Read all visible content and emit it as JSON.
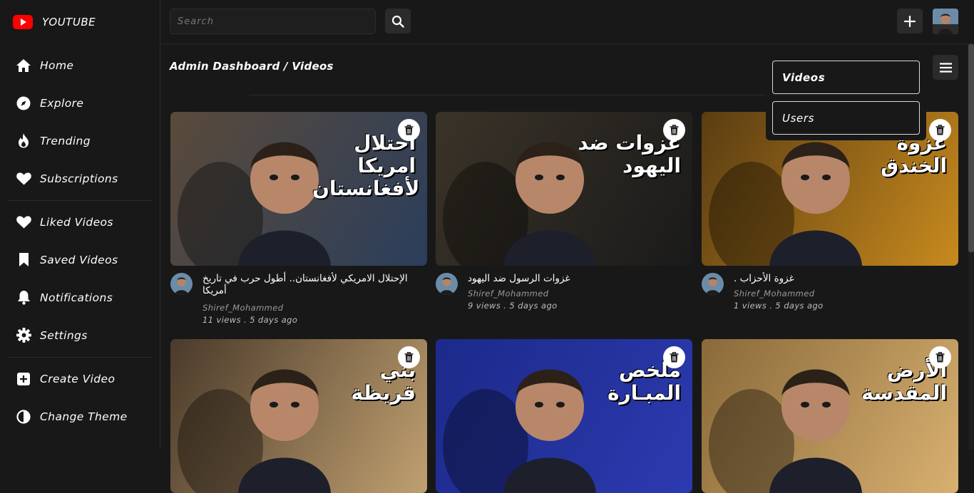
{
  "brand": {
    "name": "YOUTUBE"
  },
  "sidebar": {
    "groups": [
      [
        {
          "label": "Home",
          "icon": "home-icon"
        },
        {
          "label": "Explore",
          "icon": "compass-icon"
        },
        {
          "label": "Trending",
          "icon": "fire-icon"
        },
        {
          "label": "Subscriptions",
          "icon": "heart-icon"
        }
      ],
      [
        {
          "label": "Liked Videos",
          "icon": "heart-icon"
        },
        {
          "label": "Saved Videos",
          "icon": "bookmark-icon"
        },
        {
          "label": "Notifications",
          "icon": "bell-icon"
        },
        {
          "label": "Settings",
          "icon": "gear-icon"
        }
      ],
      [
        {
          "label": "Create Video",
          "icon": "plus-square-icon"
        },
        {
          "label": "Change Theme",
          "icon": "contrast-icon"
        }
      ]
    ]
  },
  "search": {
    "placeholder": "Search"
  },
  "breadcrumb": "Admin Dashboard / Videos",
  "dropdown": {
    "items": [
      "Videos",
      "Users"
    ]
  },
  "videos": [
    {
      "title": "الإحتلال الامريكي لأفغانستان.. أطول حرب في تاريخ أمريكا",
      "thumb_text": "احتلال امريكا لأفغانستان",
      "channel": "Shiref_Mohammed",
      "views": "11 views",
      "time": "5 days ago",
      "colors": [
        "#5a4a3a",
        "#2b3e5c"
      ]
    },
    {
      "title": "غزوات الرسول ضد اليهود",
      "thumb_text": "غزوات ضد اليهود",
      "channel": "Shiref_Mohammed",
      "views": "9 views",
      "time": "5 days ago",
      "colors": [
        "#3a3328",
        "#1a1a1a"
      ]
    },
    {
      "title": "غزوة الأحزاب .",
      "thumb_text": "غزوة الخندق",
      "channel": "Shiref_Mohammed",
      "views": "1 views",
      "time": "5 days ago",
      "colors": [
        "#5a3d12",
        "#c88a1e"
      ]
    },
    {
      "title": "",
      "thumb_text": "بني قريظة",
      "channel": "",
      "views": "",
      "time": "",
      "colors": [
        "#4a3a2a",
        "#c0a070"
      ]
    },
    {
      "title": "",
      "thumb_text": "ملخص المبـارة",
      "channel": "",
      "views": "",
      "time": "",
      "colors": [
        "#1c2a8a",
        "#2c3ab0"
      ]
    },
    {
      "title": "",
      "thumb_text": "الأرض المقدسة",
      "channel": "",
      "views": "",
      "time": "",
      "colors": [
        "#8a6a3a",
        "#d8b070"
      ]
    }
  ],
  "colors": {
    "background": "#181818",
    "accent": "#ff0000",
    "panel": "#2b2b2b"
  }
}
